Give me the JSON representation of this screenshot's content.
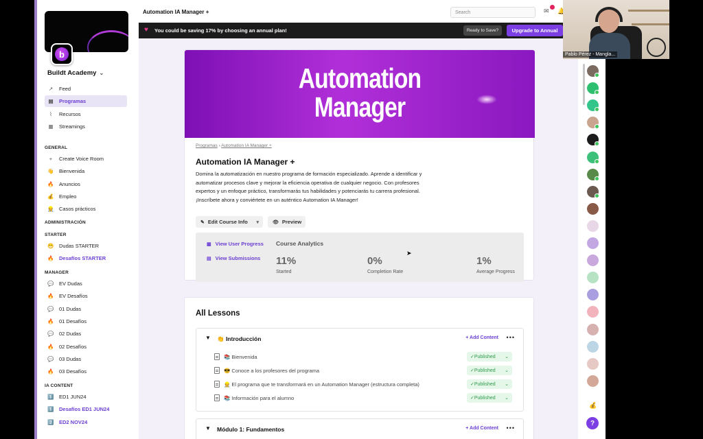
{
  "app": {
    "page_title": "Automation IA Manager +",
    "accent": "#7b3fe4"
  },
  "sidebar": {
    "community": "Buildt Academy",
    "main_items": [
      {
        "icon": "trend-icon",
        "label": "Feed"
      },
      {
        "icon": "book-icon",
        "label": "Programas"
      },
      {
        "icon": "paperclip-icon",
        "label": "Recursos"
      },
      {
        "icon": "calendar-icon",
        "label": "Streamings"
      }
    ],
    "sections": [
      {
        "title": "GENERAL",
        "items": [
          {
            "icon": "+",
            "label": "Create Voice Room"
          },
          {
            "icon": "👋",
            "label": "Bienvenida"
          },
          {
            "icon": "🔥",
            "label": "Anuncios"
          },
          {
            "icon": "💰",
            "label": "Empleo"
          },
          {
            "icon": "👷",
            "label": "Casos prácticos"
          }
        ]
      },
      {
        "title": "ADMINISTRACIÓN",
        "items": []
      },
      {
        "title": "STARTER",
        "items": [
          {
            "icon": "😁",
            "label": "Dudas STARTER"
          },
          {
            "icon": "🔥",
            "label": "Desafíos STARTER"
          }
        ]
      },
      {
        "title": "MANAGER",
        "items": [
          {
            "icon": "💬",
            "label": "EV Dudas"
          },
          {
            "icon": "🔥",
            "label": "EV Desafíos"
          },
          {
            "icon": "💬",
            "label": "01 Dudas"
          },
          {
            "icon": "🔥",
            "label": "01 Desafíos"
          },
          {
            "icon": "💬",
            "label": "02 Dudas"
          },
          {
            "icon": "🔥",
            "label": "02 Desafíos"
          },
          {
            "icon": "💬",
            "label": "03 Dudas"
          },
          {
            "icon": "🔥",
            "label": "03 Desafíos"
          }
        ]
      },
      {
        "title": "IA CONTENT",
        "items": [
          {
            "icon": "1️⃣",
            "label": "ED1 JUN24"
          },
          {
            "icon": "1️⃣",
            "label": "Desafíos ED1 JUN24"
          },
          {
            "icon": "2️⃣",
            "label": "ED2 NOV24"
          }
        ]
      }
    ]
  },
  "topbar": {
    "search_placeholder": "Search"
  },
  "promo": {
    "text": "You could be saving 17% by choosing an annual plan!",
    "ready": "Ready to Save?",
    "upgrade": "Upgrade to Annual"
  },
  "course": {
    "hero_line1": "Automation",
    "hero_line2": "Manager",
    "crumb1": "Programas",
    "crumb2": "Automation IA Manager +",
    "title": "Automation IA Manager +",
    "description": "Domina la automatización en nuestro programa de formación especializado. Aprende a identificar y automatizar procesos clave y mejorar la eficiencia operativa de cualquier negocio. Con profesores expertos y un enfoque práctico, transformarás tus habilidades y potenciarás tu carrera profesional. ¡Inscríbete ahora y conviértete en un auténtico Automation IA Manager!",
    "edit_label": "Edit Course Info",
    "preview_label": "Preview",
    "links": [
      "View User Progress",
      "View Submissions"
    ],
    "analytics_title": "Course Analytics",
    "stats": [
      {
        "value": "11%",
        "label": "Started"
      },
      {
        "value": "0%",
        "label": "Completion Rate"
      },
      {
        "value": "1%",
        "label": "Average Progress"
      }
    ]
  },
  "lessons": {
    "title": "All Lessons",
    "add_label": "+ Add Content",
    "published_label": "Published",
    "modules": [
      {
        "name": "👏 Introducción",
        "lessons": [
          "📚 Bienvenida",
          "😎 Conoce a los profesores del programa",
          "👷 El programa que te transformará en un Automation Manager (estructura completa)",
          "📚 Información para el alumno"
        ]
      },
      {
        "name": "Módulo 1: Fundamentos",
        "lessons": []
      }
    ]
  },
  "webcam": {
    "name": "Pablo Pérez - Mangla..."
  }
}
